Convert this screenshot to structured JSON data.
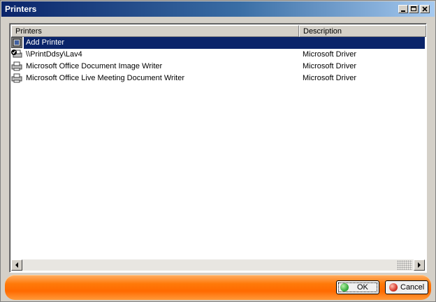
{
  "window": {
    "title": "Printers"
  },
  "titlebar_buttons": [
    "minimize-icon",
    "maximize-icon",
    "close-icon"
  ],
  "list": {
    "columns": [
      "Printers",
      "Description"
    ],
    "rows": [
      {
        "name": "Add Printer",
        "description": "",
        "icon": "add-printer-icon",
        "selected": true
      },
      {
        "name": "\\\\PrintDdsy\\Lav4",
        "description": "Microsoft Driver",
        "icon": "default-printer-icon",
        "selected": false
      },
      {
        "name": "Microsoft Office Document Image Writer",
        "description": "Microsoft Driver",
        "icon": "printer-icon",
        "selected": false
      },
      {
        "name": "Microsoft Office Live Meeting Document Writer",
        "description": "Microsoft Driver",
        "icon": "printer-icon",
        "selected": false
      }
    ]
  },
  "buttons": {
    "ok": "OK",
    "cancel": "Cancel"
  },
  "colors": {
    "selection": "#0a246a",
    "title_start": "#0a246a",
    "bottom_bar": "#ff7a0a",
    "ok_icon": "#3cb043",
    "cancel_icon": "#d83a2e"
  }
}
